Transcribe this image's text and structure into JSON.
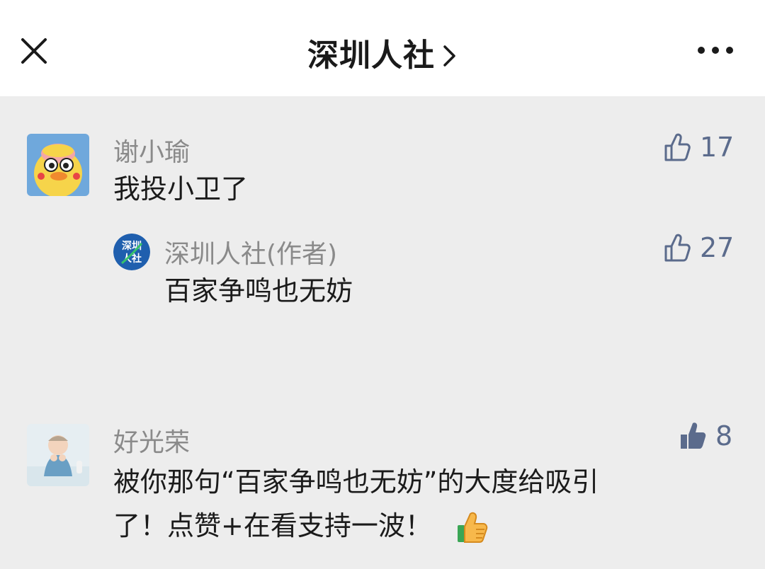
{
  "header": {
    "title": "深圳人社",
    "chevron_icon": "chevron-right-icon",
    "close_icon": "close-icon",
    "more_icon": "more-icon"
  },
  "comments": [
    {
      "author": "谢小瑜",
      "text": "我投小卫了",
      "likes": "17",
      "liked": false,
      "reply": {
        "author": "深圳人社(作者)",
        "avatar_text": [
          "深圳",
          "人社"
        ],
        "text": "百家争鸣也无妨",
        "likes": "27",
        "liked": false
      }
    },
    {
      "author": "好光荣",
      "text_line1": "被你那句“百家争鸣也无妨”的大度给吸引",
      "text_line2": "了！点赞+在看支持一波！",
      "likes": "8",
      "liked": true
    }
  ],
  "colors": {
    "background": "#ededed",
    "header_bg": "#ffffff",
    "like_color": "#5b6b8c",
    "name_color": "#8a8a8a"
  }
}
